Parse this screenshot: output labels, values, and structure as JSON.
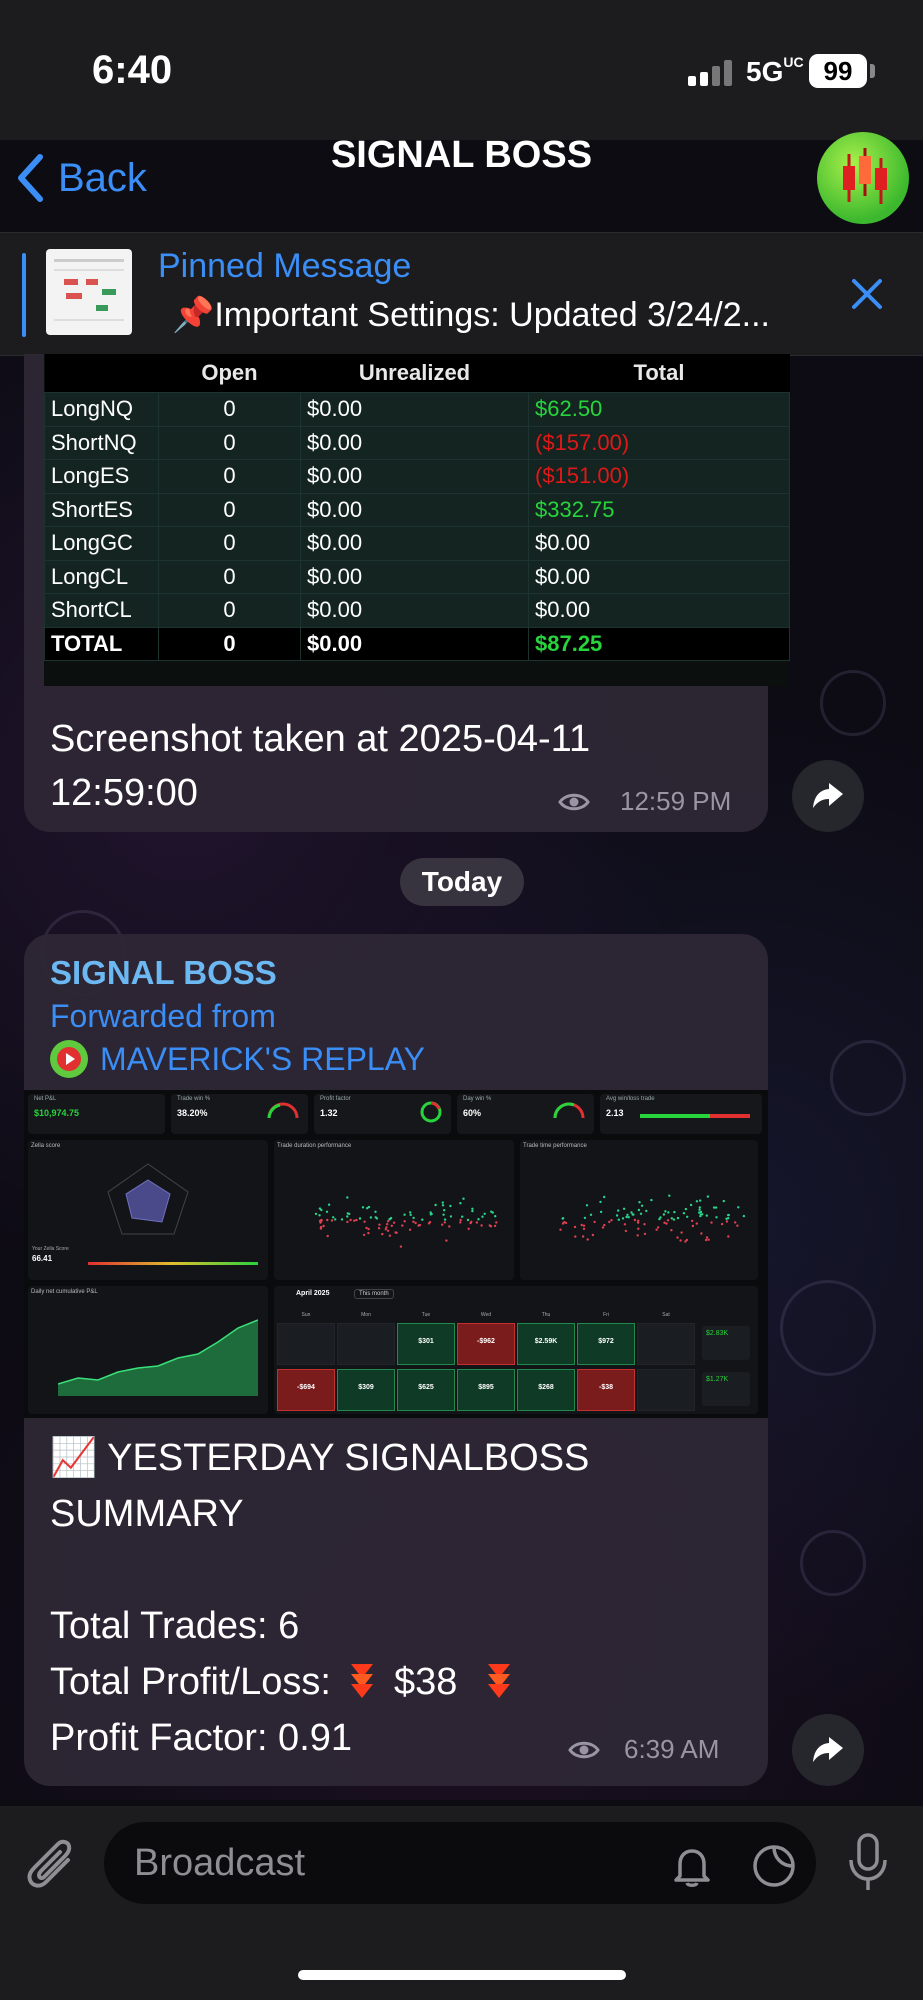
{
  "status_bar": {
    "time": "6:40",
    "network": "5G",
    "network_sup": "UC",
    "battery": "99"
  },
  "header": {
    "back_label": "Back",
    "title": "SIGNAL BOSS"
  },
  "pinned": {
    "title": "Pinned Message",
    "text": "📌Important Settings: Updated 3/24/2..."
  },
  "pnl_table": {
    "headers": [
      "",
      "Open",
      "Unrealized",
      "Total"
    ],
    "rows": [
      {
        "name": "LongNQ",
        "open": "0",
        "unrealized": "$0.00",
        "total": "$62.50",
        "tone": "pos"
      },
      {
        "name": "ShortNQ",
        "open": "0",
        "unrealized": "$0.00",
        "total": "($157.00)",
        "tone": "neg"
      },
      {
        "name": "LongES",
        "open": "0",
        "unrealized": "$0.00",
        "total": "($151.00)",
        "tone": "neg"
      },
      {
        "name": "ShortES",
        "open": "0",
        "unrealized": "$0.00",
        "total": "$332.75",
        "tone": "pos"
      },
      {
        "name": "LongGC",
        "open": "0",
        "unrealized": "$0.00",
        "total": "$0.00",
        "tone": ""
      },
      {
        "name": "LongCL",
        "open": "0",
        "unrealized": "$0.00",
        "total": "$0.00",
        "tone": ""
      },
      {
        "name": "ShortCL",
        "open": "0",
        "unrealized": "$0.00",
        "total": "$0.00",
        "tone": ""
      }
    ],
    "total_row": {
      "name": "TOTAL",
      "open": "0",
      "unrealized": "$0.00",
      "total": "$87.25",
      "tone": "pos"
    }
  },
  "message1": {
    "caption": "Screenshot taken at 2025-04-11 12:59:00",
    "time": "12:59 PM"
  },
  "day_separator": "Today",
  "message2": {
    "sender": "SIGNAL BOSS",
    "forwarded_label": "Forwarded from",
    "forwarded_name": "MAVERICK'S REPLAY",
    "summary_title": "📈 YESTERDAY SIGNALBOSS SUMMARY",
    "total_trades": "Total Trades: 6",
    "profit_loss_label": "Total Profit/Loss:",
    "profit_loss_value": "$38",
    "profit_factor": "Profit Factor:  0.91",
    "time": "6:39 AM"
  },
  "dashboard": {
    "net_pnl_label": "Net P&L",
    "net_pnl": "$10,974.75",
    "trade_win_label": "Trade win %",
    "trade_win": "38.20%",
    "profit_factor_label": "Profit factor",
    "profit_factor": "1.32",
    "day_win_label": "Day win %",
    "day_win": "60%",
    "avg_win_loss_label": "Avg win/loss trade",
    "avg_win_loss": "2.13",
    "zella_label": "Zella score",
    "zella_score_label": "Your Zella Score",
    "zella_score": "66.41",
    "duration_label": "Trade duration performance",
    "time_label": "Trade time performance",
    "cumulative_label": "Daily net cumulative P&L",
    "calendar_month": "April 2025",
    "this_month": "This month",
    "weekdays": [
      "Sun",
      "Mon",
      "Tue",
      "Wed",
      "Thu",
      "Fri",
      "Sat"
    ],
    "week1": [
      {
        "v": "",
        "c": "empty"
      },
      {
        "v": "",
        "c": "empty"
      },
      {
        "v": "$301",
        "c": "pos"
      },
      {
        "v": "-$962",
        "c": "neg"
      },
      {
        "v": "$2.59K",
        "c": "pos"
      },
      {
        "v": "$972",
        "c": "pos"
      },
      {
        "v": "",
        "c": "empty"
      }
    ],
    "week2": [
      {
        "v": "-$694",
        "c": "neg"
      },
      {
        "v": "$309",
        "c": "pos"
      },
      {
        "v": "$625",
        "c": "pos"
      },
      {
        "v": "$895",
        "c": "pos"
      },
      {
        "v": "$268",
        "c": "pos"
      },
      {
        "v": "-$38",
        "c": "neg"
      },
      {
        "v": "",
        "c": "empty"
      }
    ],
    "week1_total": "$2.83K",
    "week2_total": "$1.27K"
  },
  "input": {
    "placeholder": "Broadcast"
  },
  "colors": {
    "accent": "#3a8ef6",
    "positive": "#28d43c",
    "negative": "#e01818",
    "bubble": "#2e2634"
  }
}
